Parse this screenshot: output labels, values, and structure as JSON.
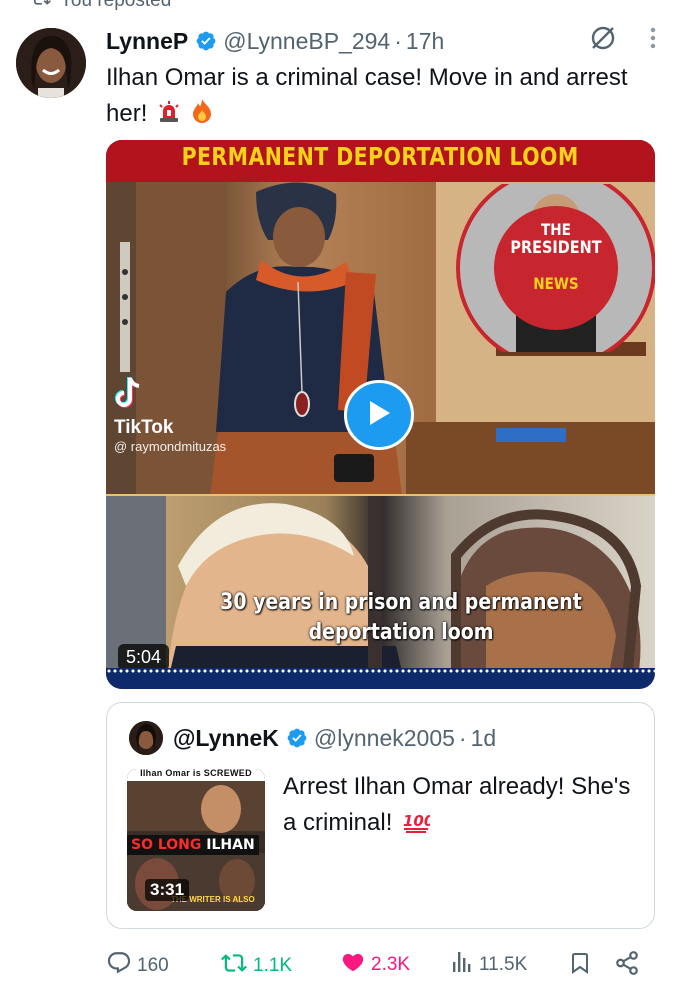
{
  "context": {
    "reposted_label": "You reposted"
  },
  "tweet": {
    "display_name": "LynneP",
    "handle": "@LynneBP_294",
    "separator": "·",
    "time": "17h",
    "text": "Ilhan Omar is a criminal case! Move in and arrest her!",
    "media": {
      "banner_text": "PERMANENT DEPORTATION LOOM",
      "badge_line1": "THE",
      "badge_line2": "PRESIDENT",
      "badge_line3": "NEWS",
      "tiktok_label": "TikTok",
      "tiktok_user": "@ raymondmituzas",
      "caption": "30 years in prison and permanent deportation loom",
      "duration": "5:04"
    },
    "quote": {
      "display_name": "@LynneK",
      "handle": "@lynnek2005",
      "separator": "·",
      "time": "1d",
      "text": "Arrest Ilhan Omar already! She's a criminal!",
      "thumb_title": "Ilhan Omar is SCREWED",
      "thumb_label_red": "SO LONG",
      "thumb_label": "ILHAN",
      "thumb_footer": "THE WRITER IS ALSO",
      "thumb_duration": "3:31"
    },
    "actions": {
      "replies": "160",
      "reposts": "1.1K",
      "likes": "2.3K",
      "views": "11.5K"
    }
  },
  "colors": {
    "accent": "#1d9bf0",
    "repost": "#00ba7c",
    "like": "#f91880",
    "muted": "#536471"
  },
  "icons": [
    "repost-icon",
    "verified-badge-icon",
    "grok-icon",
    "more-icon",
    "siren-emoji-icon",
    "fire-emoji-icon",
    "play-icon",
    "tiktok-icon",
    "hundred-emoji-icon",
    "reply-icon",
    "like-icon",
    "views-icon",
    "bookmark-icon",
    "share-icon"
  ]
}
